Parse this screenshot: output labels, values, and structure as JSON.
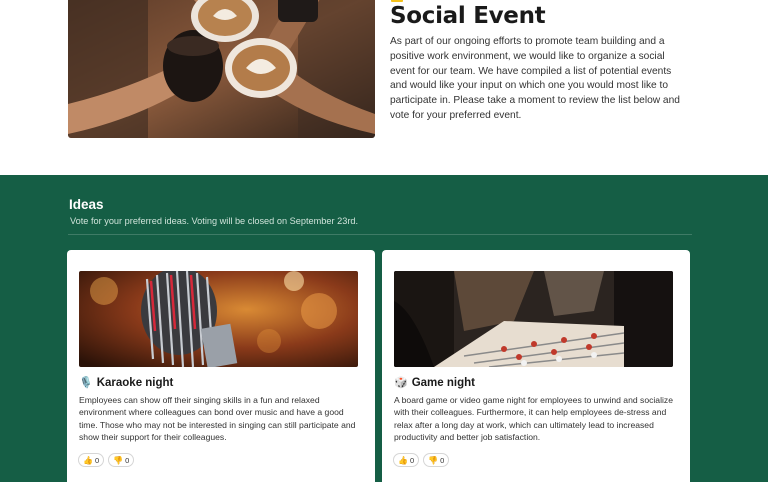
{
  "hero": {
    "title": "Social Event",
    "body": "As part of our ongoing efforts to promote team building and a positive work environment, we would like to organize a social event for our team. We have compiled a list of potential events and would like your input on which one you would most like to participate in. Please take a moment to review the list below and vote for your preferred event.",
    "image_icon": "coffee-cheers-photo"
  },
  "ideas": {
    "title": "Ideas",
    "subtitle": "Vote for your preferred ideas. Voting will be closed on September 23rd.",
    "cards": [
      {
        "icon": "microphone-icon",
        "icon_glyph": "🎙️",
        "title": "Karaoke night",
        "description": "Employees can show off their singing skills in a fun and relaxed environment where colleagues can bond over music and have a good time. Those who may not be interested in singing can still participate and show their support for their colleagues.",
        "upvotes": "0",
        "downvotes": "0"
      },
      {
        "icon": "game-die-icon",
        "icon_glyph": "🎲",
        "title": "Game night",
        "description": "A board game or video game night for employees to unwind and socialize with their colleagues. Furthermore, it can help employees de-stress and relax after a long day at work, which can ultimately lead to increased productivity and better job satisfaction.",
        "upvotes": "0",
        "downvotes": "0"
      }
    ]
  },
  "colors": {
    "section_bg": "#155e45",
    "accent": "#f5c21b"
  }
}
